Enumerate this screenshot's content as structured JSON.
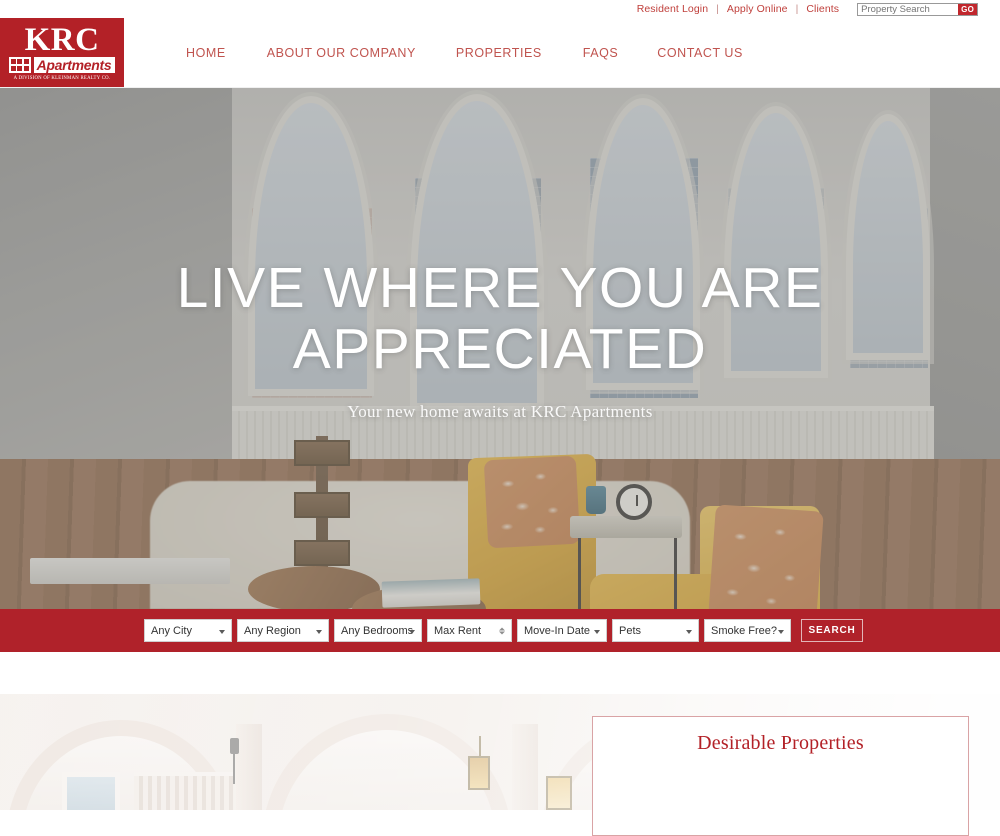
{
  "utility": {
    "links": [
      {
        "label": "Resident Login"
      },
      {
        "label": "Apply Online"
      },
      {
        "label": "Clients"
      }
    ],
    "separator": "|",
    "search_placeholder": "Property Search",
    "search_value": "",
    "go_label": "GO"
  },
  "brand": {
    "name": "KRC",
    "word": "Apartments",
    "tagline": "A DIVISION OF KLEINMAN REALTY CO.",
    "primary_color": "#b32127",
    "bar_color": "#b0222a",
    "nav_link_color": "#c0544f",
    "utility_link_color": "#c0403c"
  },
  "nav": {
    "items": [
      {
        "label": "HOME"
      },
      {
        "label": "ABOUT OUR COMPANY"
      },
      {
        "label": "PROPERTIES"
      },
      {
        "label": "FAQS"
      },
      {
        "label": "CONTACT US"
      }
    ]
  },
  "hero": {
    "headline_line1": "LIVE WHERE YOU ARE",
    "headline_line2": "APPRECIATED",
    "subtitle": "Your new home awaits at KRC Apartments"
  },
  "filters": {
    "city": {
      "label": "Any City"
    },
    "region": {
      "label": "Any Region"
    },
    "bedrooms": {
      "label": "Any Bedrooms"
    },
    "max_rent": {
      "placeholder": "Max Rent",
      "value": ""
    },
    "move_in_date": {
      "label": "Move-In Date"
    },
    "pets": {
      "label": "Pets"
    },
    "smoke_free": {
      "label": "Smoke Free?"
    },
    "search_button": "SEARCH"
  },
  "lower": {
    "panel_title": "Desirable Properties"
  }
}
